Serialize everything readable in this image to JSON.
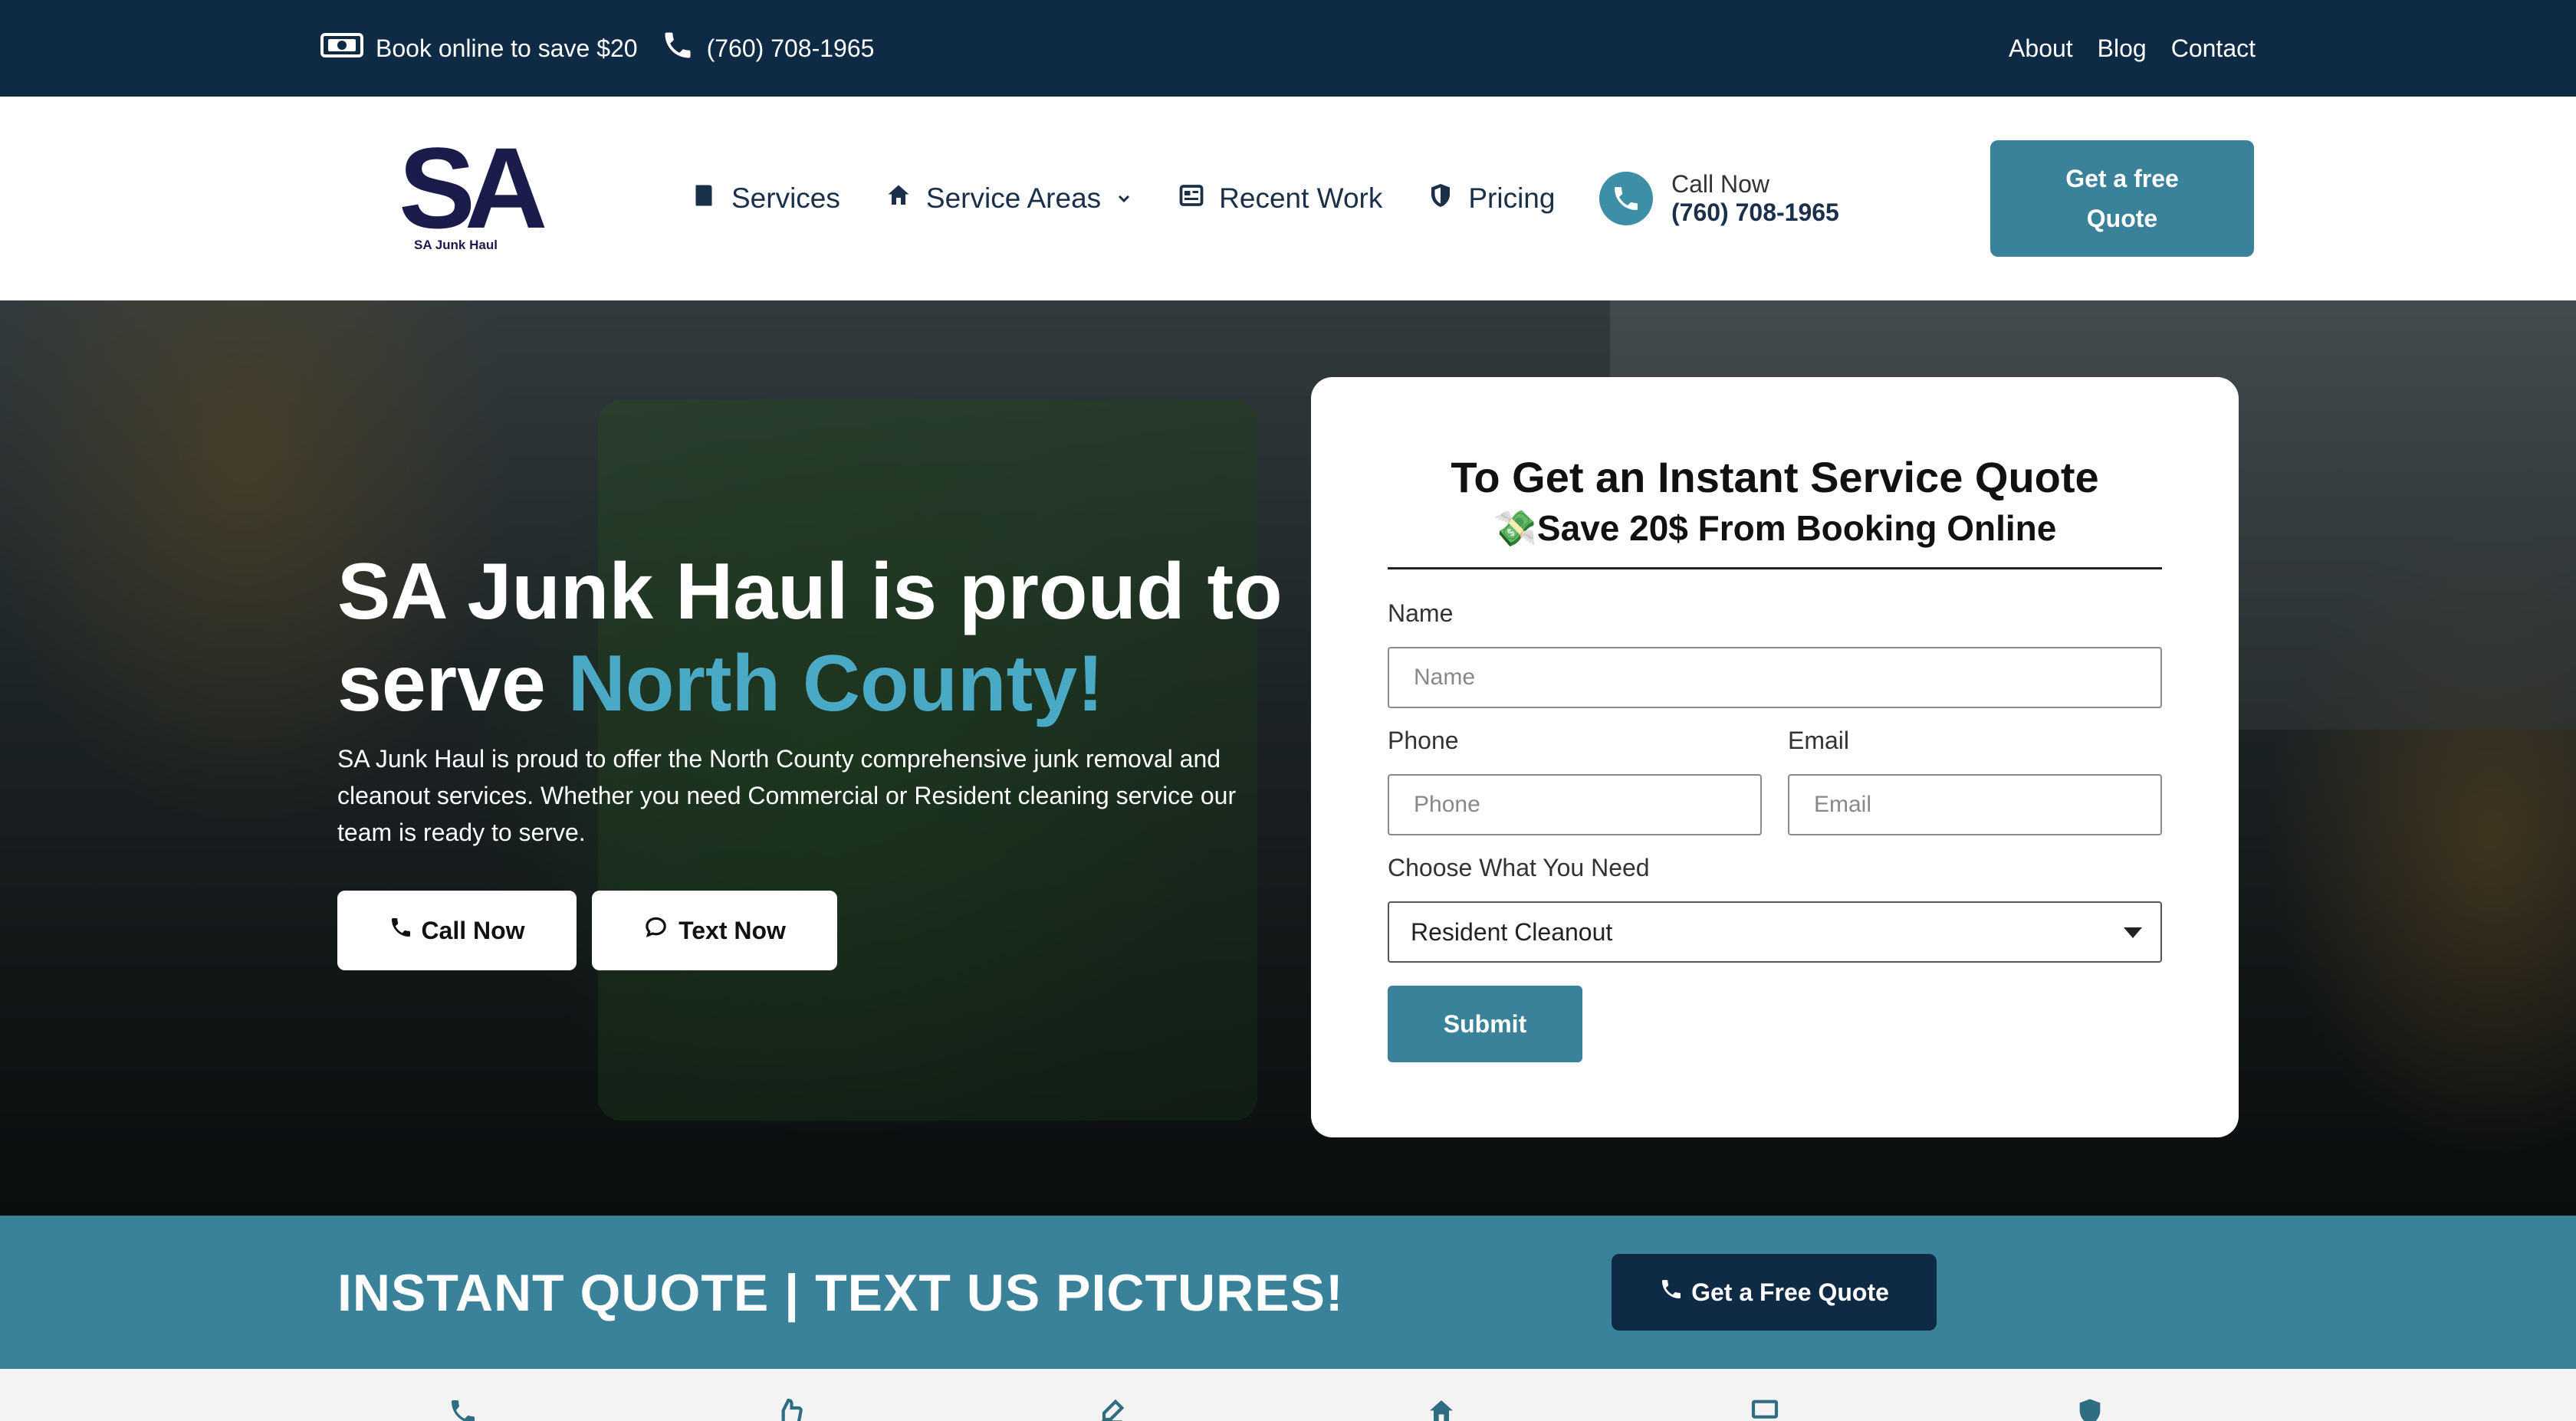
{
  "topbar": {
    "promo_text": "Book online to save $20",
    "phone": "(760) 708-1965",
    "links": [
      "About",
      "Blog",
      "Contact"
    ],
    "promo_icon": "cash-icon",
    "phone_icon": "phone-icon"
  },
  "header": {
    "logo": {
      "mark": "SA",
      "name": "SA Junk Haul"
    },
    "nav": [
      {
        "label": "Services",
        "icon": "book-icon"
      },
      {
        "label": "Service Areas",
        "icon": "home-icon",
        "dropdown": true
      },
      {
        "label": "Recent Work",
        "icon": "newspaper-icon"
      },
      {
        "label": "Pricing",
        "icon": "shield-icon"
      }
    ],
    "call": {
      "label": "Call Now",
      "phone": "(760) 708-1965"
    },
    "quote_button": "Get a free Quote"
  },
  "hero": {
    "title_main": "SA Junk Haul is proud to serve ",
    "title_accent": "North County!",
    "description": "SA Junk Haul is proud to offer the North County comprehensive junk removal and cleanout services. Whether you need Commercial or Resident cleaning service our team is ready to serve.",
    "call_button": "Call Now",
    "text_button": "Text Now"
  },
  "form": {
    "title": "To Get an Instant Service Quote",
    "subtitle": "💸Save 20$ From Booking Online",
    "name_label": "Name",
    "name_placeholder": "Name",
    "phone_label": "Phone",
    "phone_placeholder": "Phone",
    "email_label": "Email",
    "email_placeholder": "Email",
    "need_label": "Choose What You Need",
    "need_value": "Resident Cleanout",
    "submit": "Submit"
  },
  "cta": {
    "title": "INSTANT QUOTE | TEXT US PICTURES!",
    "button": "Get a Free Quote"
  },
  "colors": {
    "navy": "#0e2a45",
    "teal": "#3a8299",
    "accent_text": "#4aaac6",
    "logo": "#1b1c4b"
  }
}
